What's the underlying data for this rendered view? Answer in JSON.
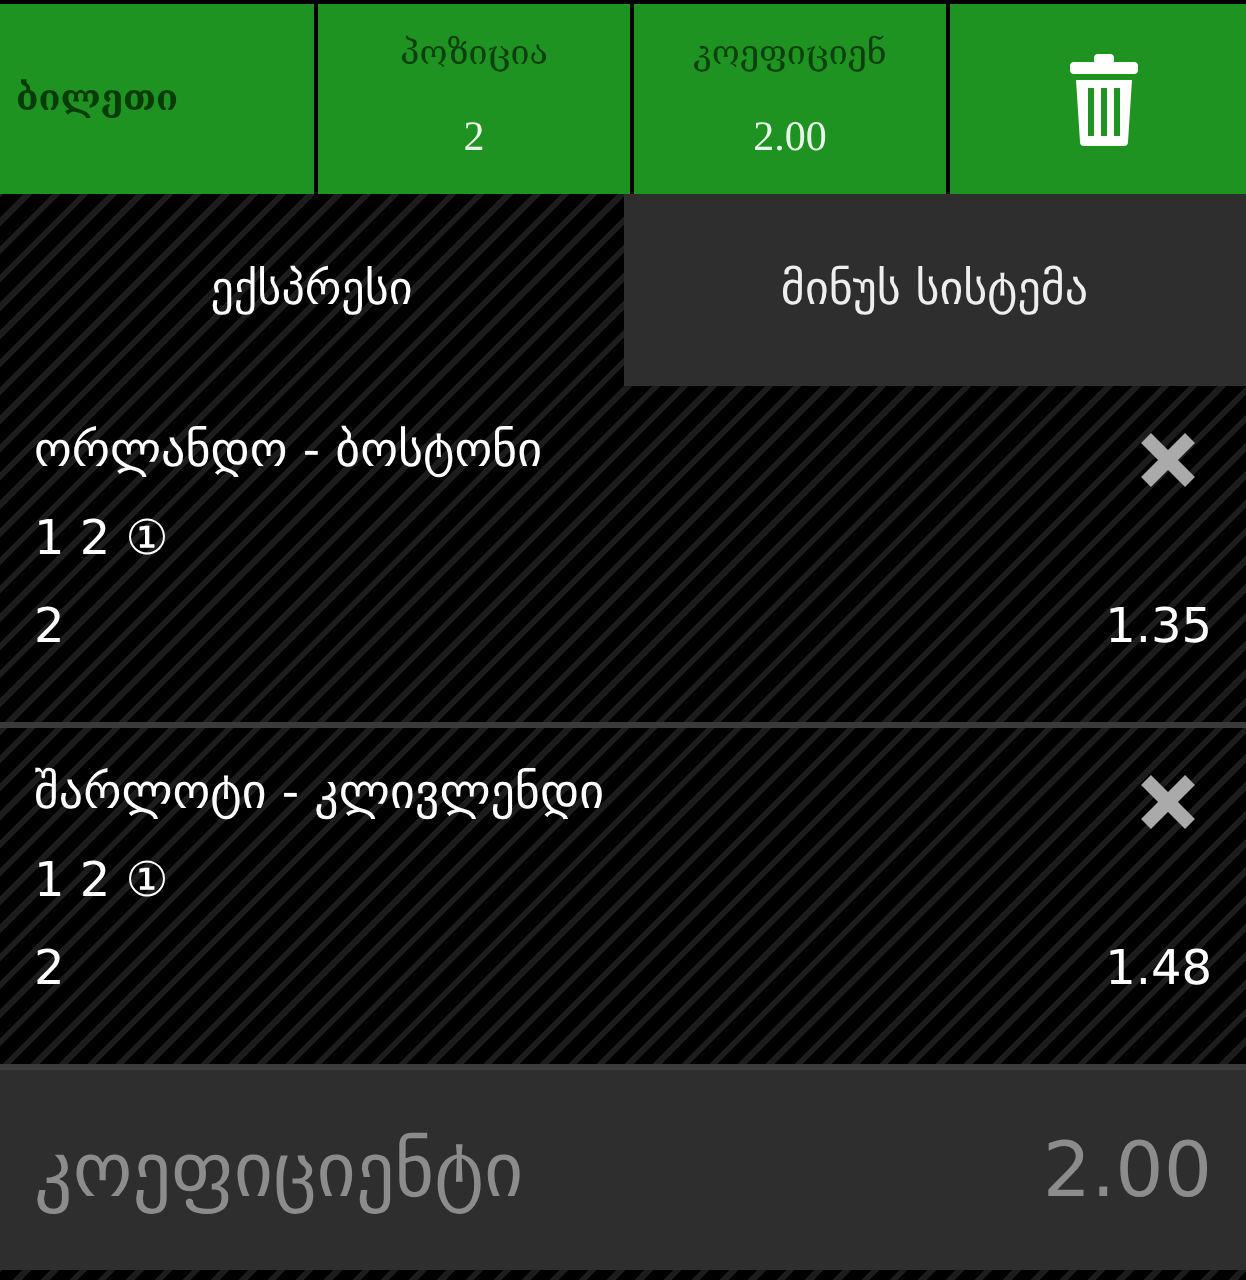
{
  "header": {
    "ticket_label": "ბილეთი",
    "stats": [
      {
        "label": "პოზიცია",
        "value": "2"
      },
      {
        "label": "კოეფიციენ",
        "value": "2.00"
      }
    ]
  },
  "tabs": [
    {
      "label": "ექსპრესი",
      "selected": true
    },
    {
      "label": "მინუს სისტემა",
      "selected": false
    }
  ],
  "bets": [
    {
      "match": "ორლანდო - ბოსტონი",
      "outcomes": "1 2 ①",
      "pick": "2",
      "odds": "1.35"
    },
    {
      "match": "შარლოტი - კლივლენდი",
      "outcomes": "1 2 ①",
      "pick": "2",
      "odds": "1.48"
    }
  ],
  "footer": {
    "label": "კოეფიციენტი",
    "value": "2.00"
  }
}
